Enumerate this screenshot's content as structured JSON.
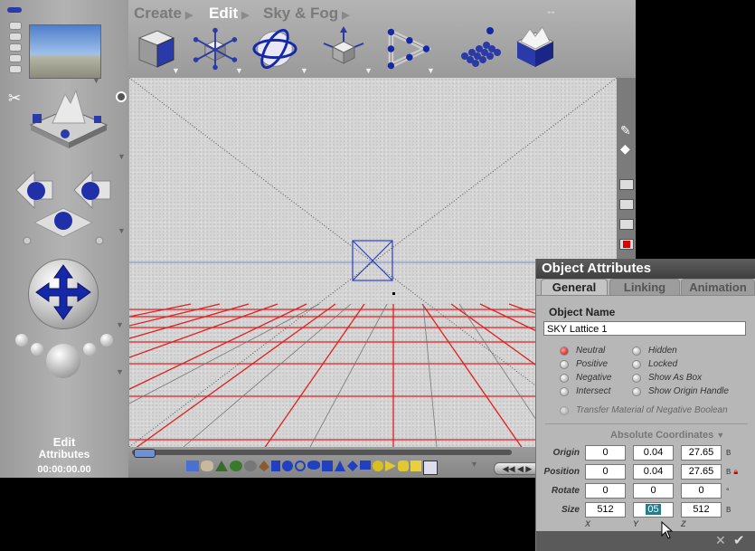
{
  "menu": {
    "create": "Create",
    "edit": "Edit",
    "sky_fog": "Sky & Fog"
  },
  "left_panel": {
    "mode_title": "Edit",
    "mode_subtitle": "Attributes",
    "timecode": "00:00:00.00"
  },
  "dialog": {
    "title": "Object Attributes",
    "tabs": [
      "General",
      "Linking",
      "Animation"
    ],
    "object_name_label": "Object Name",
    "object_name_value": "SKY Lattice 1",
    "options_left": [
      "Neutral",
      "Positive",
      "Negative",
      "Intersect"
    ],
    "options_right": [
      "Hidden",
      "Locked",
      "Show As Box",
      "Show Origin Handle"
    ],
    "selected_option": "Neutral",
    "transfer_label": "Transfer Material of Negative Boolean",
    "coords_header": "Absolute Coordinates",
    "rows": [
      {
        "label": "Origin",
        "values": [
          "0",
          "0.04",
          "27.65"
        ],
        "suffix": "B"
      },
      {
        "label": "Position",
        "values": [
          "0",
          "0.04",
          "27.65"
        ],
        "suffix": "B"
      },
      {
        "label": "Rotate",
        "values": [
          "0",
          "0",
          "0"
        ],
        "suffix": "°"
      },
      {
        "label": "Size",
        "values": [
          "512",
          "05",
          "512"
        ],
        "suffix": "B"
      }
    ],
    "axes": [
      "X",
      "Y",
      "Z"
    ]
  },
  "colors": {
    "grid": "#e02020",
    "selection": "#3040c0",
    "horizon": "#6a8fd8"
  }
}
